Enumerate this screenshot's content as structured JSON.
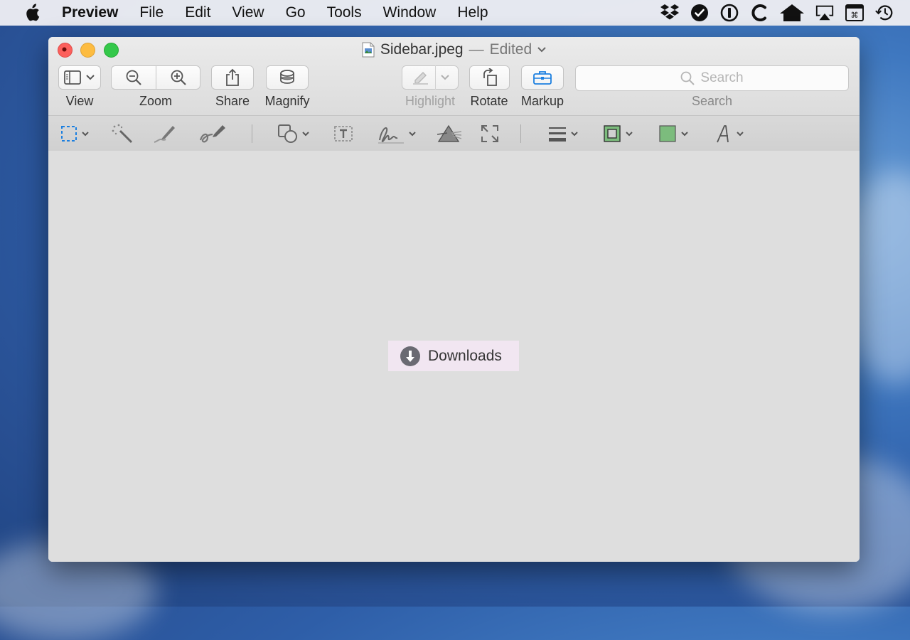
{
  "menubar": {
    "app_name": "Preview",
    "items": [
      "File",
      "Edit",
      "View",
      "Go",
      "Tools",
      "Window",
      "Help"
    ],
    "status_icons": [
      "dropbox-icon",
      "checkmark-circle-icon",
      "onepassword-icon",
      "c-app-icon",
      "home-icon",
      "airplay-icon",
      "keyboard-viewer-icon",
      "time-machine-icon"
    ]
  },
  "window": {
    "title": "Sidebar.jpeg",
    "title_separator": "—",
    "title_status": "Edited",
    "toolbar": {
      "view_label": "View",
      "zoom_label": "Zoom",
      "share_label": "Share",
      "magnify_label": "Magnify",
      "highlight_label": "Highlight",
      "rotate_label": "Rotate",
      "markup_label": "Markup",
      "search_label": "Search",
      "search_placeholder": "Search"
    },
    "colors": {
      "close": "#fc605c",
      "minimize": "#fdbc40",
      "zoom": "#34c84a",
      "markup_accent": "#1b7fe0",
      "fill_color": "#7cbc7d",
      "downloads_bg": "#f1e6f1"
    },
    "content": {
      "downloads_label": "Downloads"
    }
  }
}
